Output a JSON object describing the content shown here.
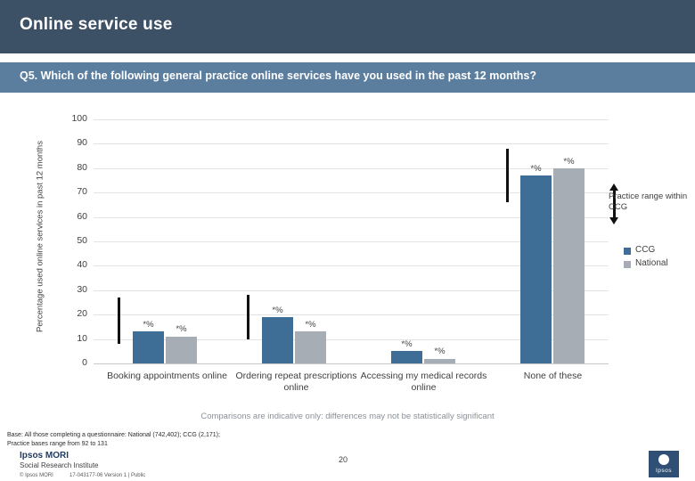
{
  "header": {
    "title": "Online service use",
    "question": "Q5. Which of the following general practice online services have you used in the past 12 months?"
  },
  "legend": {
    "ccg": "CCG",
    "national": "National"
  },
  "range_callout": "Practice range within CCG",
  "note": "Comparisons are indicative only: differences may not be statistically significant",
  "base_text_line1": "Base: All those completing a questionnaire: National (742,402); CCG (2,171);",
  "base_text_line2": "Practice bases range from 92 to 131",
  "footer": {
    "brand": "Ipsos MORI",
    "brand_sub": "Social Research Institute",
    "copyright": "© Ipsos MORI",
    "version": "17-043177-06 Version 1 | Public",
    "page_number": "20",
    "logo_text": "Ipsos"
  },
  "chart_data": {
    "type": "bar",
    "title": "",
    "xlabel": "",
    "ylabel": "Percentage used online services in past 12 months",
    "ylim": [
      0,
      100
    ],
    "yticks": [
      0,
      10,
      20,
      30,
      40,
      50,
      60,
      70,
      80,
      90,
      100
    ],
    "grid": true,
    "legend_position": "right",
    "categories": [
      "Booking appointments online",
      "Ordering repeat prescriptions online",
      "Accessing my medical records online",
      "None of these"
    ],
    "series": [
      {
        "name": "CCG",
        "color": "#3e6e96",
        "values": [
          13,
          19,
          5,
          77
        ]
      },
      {
        "name": "National",
        "color": "#a7adb5",
        "values": [
          11,
          13,
          2,
          80
        ]
      }
    ],
    "data_labels": {
      "ccg": [
        "*%",
        "*%",
        "*%",
        "*%"
      ],
      "national": [
        "*%",
        "*%",
        "*%",
        "*%"
      ]
    },
    "practice_ranges": [
      {
        "category": "Booking appointments online",
        "low": 8,
        "high": 27
      },
      {
        "category": "Ordering repeat prescriptions online",
        "low": 10,
        "high": 28
      },
      {
        "category": "None of these",
        "low": 66,
        "high": 88
      }
    ]
  }
}
